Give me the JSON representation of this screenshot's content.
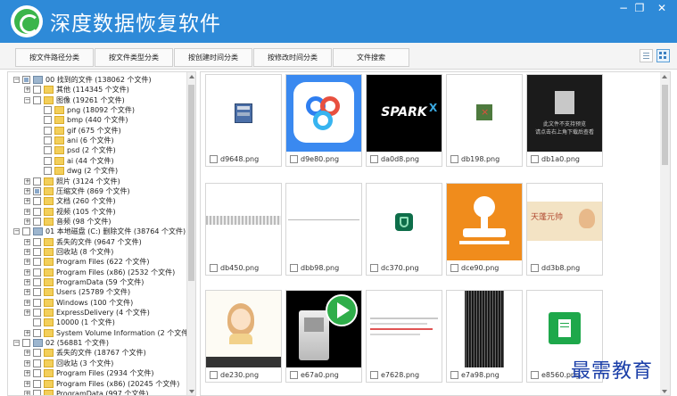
{
  "app": {
    "title": "深度数据恢复软件"
  },
  "window_controls": {
    "minimize": "−",
    "restore": "❐",
    "close": "✕"
  },
  "toolbar": {
    "tabs": [
      "按文件路径分类",
      "按文件类型分类",
      "按创建时间分类",
      "按修改时间分类",
      "文件搜索"
    ],
    "view_modes": [
      "list-view-icon",
      "grid-view-icon"
    ]
  },
  "tree": {
    "rows": [
      "00 找到的文件 (138062 个文件)",
      "其他  (114345 个文件)",
      "图像  (19261 个文件)",
      "png  (18092 个文件)",
      "bmp  (440 个文件)",
      "gif  (675 个文件)",
      "ani  (6 个文件)",
      "psd  (2 个文件)",
      "ai  (44 个文件)",
      "dwg  (2 个文件)",
      "照片  (3124 个文件)",
      "压缩文件  (869 个文件)",
      "文档  (260 个文件)",
      "视频  (105 个文件)",
      "音频  (98 个文件)",
      "01 本地磁盘 (C:) 删除文件 (38764 个文件)",
      "丢失的文件  (9647 个文件)",
      "回收站  (8 个文件)",
      "Program Files  (622 个文件)",
      "Program Files (x86)  (2532 个文件)",
      "ProgramData  (59 个文件)",
      "Users  (25789 个文件)",
      "Windows  (100 个文件)",
      "ExpressDelivery  (4 个文件)",
      "10000  (1 个文件)",
      "System Volume Information  (2 个文件)",
      "02  (56881 个文件)",
      "丢失的文件  (18767 个文件)",
      "回收站  (3 个文件)",
      "Program Files  (2934 个文件)",
      "Program Files (x86)  (20245 个文件)",
      "ProgramData  (997 个文件)"
    ]
  },
  "files": [
    {
      "name": "d9648.png",
      "thumb": "winrar-icon"
    },
    {
      "name": "d9e80.png",
      "thumb": "baidu-cloud-logo"
    },
    {
      "name": "da0d8.png",
      "thumb": "spark-logo"
    },
    {
      "name": "db198.png",
      "thumb": "small-green-icon"
    },
    {
      "name": "db1a0.png",
      "thumb": "unsupported-preview",
      "preview_line1": "此文件不支持预览",
      "preview_line2": "请点击右上角下载后查看"
    },
    {
      "name": "db450.png",
      "thumb": "gray-stripe"
    },
    {
      "name": "dbb98.png",
      "thumb": "thin-line"
    },
    {
      "name": "dc370.png",
      "thumb": "green-shield-icon"
    },
    {
      "name": "dce90.png",
      "thumb": "orange-stamp"
    },
    {
      "name": "dd3b8.png",
      "thumb": "banner-image",
      "banner_text": "天蓬元帅"
    },
    {
      "name": "de230.png",
      "thumb": "cartoon-girl"
    },
    {
      "name": "e67a0.png",
      "thumb": "computer-play"
    },
    {
      "name": "e7628.png",
      "thumb": "web-screenshot"
    },
    {
      "name": "e7a98.png",
      "thumb": "dark-noise"
    },
    {
      "name": "e8560.png",
      "thumb": "green-document"
    }
  ],
  "watermark": "最需教育",
  "colors": {
    "title_bar": "#2e8ad8",
    "folder": "#f3cf5a",
    "accent": "#3bb54a"
  }
}
